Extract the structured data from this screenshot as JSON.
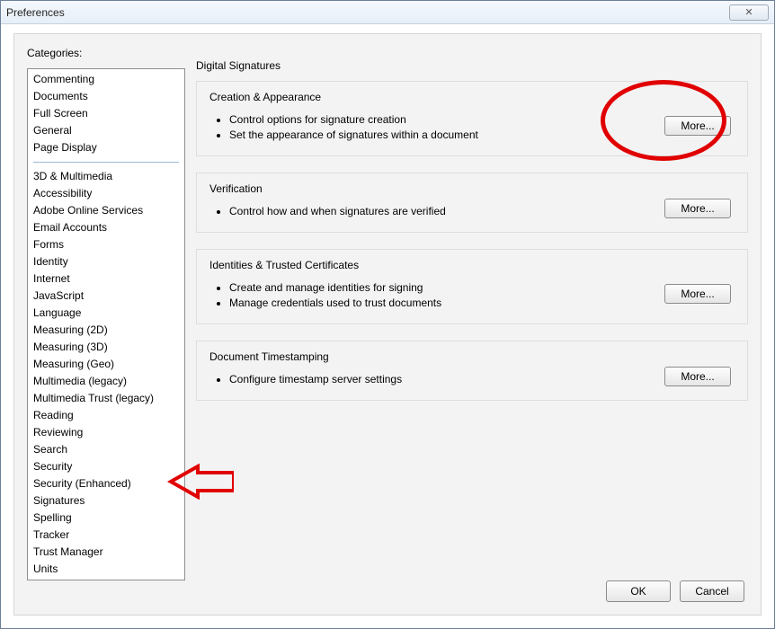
{
  "window": {
    "title": "Preferences",
    "close_glyph": "✕"
  },
  "categories_label": "Categories:",
  "categories_top": [
    "Commenting",
    "Documents",
    "Full Screen",
    "General",
    "Page Display"
  ],
  "categories_rest": [
    "3D & Multimedia",
    "Accessibility",
    "Adobe Online Services",
    "Email Accounts",
    "Forms",
    "Identity",
    "Internet",
    "JavaScript",
    "Language",
    "Measuring (2D)",
    "Measuring (3D)",
    "Measuring (Geo)",
    "Multimedia (legacy)",
    "Multimedia Trust (legacy)",
    "Reading",
    "Reviewing",
    "Search",
    "Security",
    "Security (Enhanced)",
    "Signatures",
    "Spelling",
    "Tracker",
    "Trust Manager",
    "Units"
  ],
  "pane_title": "Digital Signatures",
  "groups": {
    "creation": {
      "title": "Creation & Appearance",
      "b1": "Control options for signature creation",
      "b2": "Set the appearance of signatures within a document",
      "more": "More..."
    },
    "verification": {
      "title": "Verification",
      "b1": "Control how and when signatures are verified",
      "more": "More..."
    },
    "identities": {
      "title": "Identities & Trusted Certificates",
      "b1": "Create and manage identities for signing",
      "b2": "Manage credentials used to trust documents",
      "more": "More..."
    },
    "timestamp": {
      "title": "Document Timestamping",
      "b1": "Configure timestamp server settings",
      "more": "More..."
    }
  },
  "footer": {
    "ok": "OK",
    "cancel": "Cancel"
  },
  "annotations": {
    "ellipse_color": "#e10000",
    "arrow_color": "#e10000"
  }
}
